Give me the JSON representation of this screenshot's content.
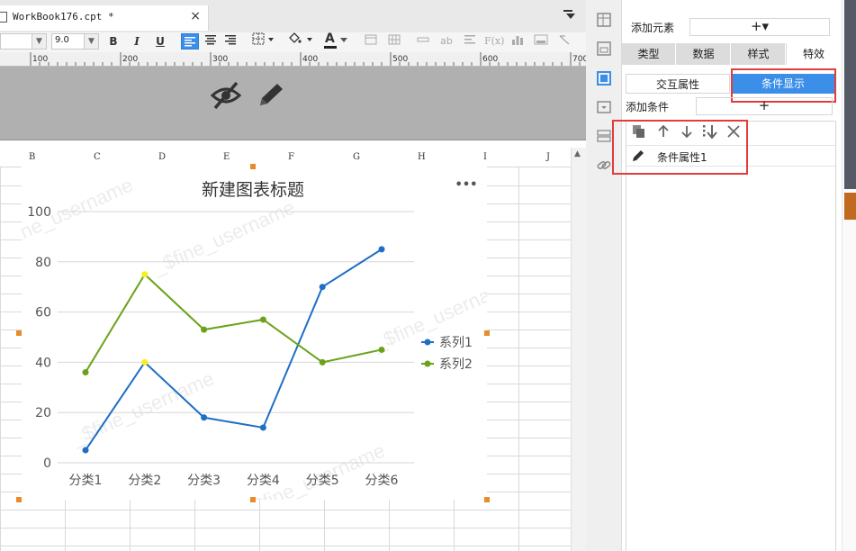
{
  "tab": {
    "title": "WorkBook176.cpt *",
    "close": "×"
  },
  "toolbar": {
    "font_size": "9.0",
    "bold": "B",
    "italic": "I",
    "underline": "U",
    "text_color_letter": "A",
    "formula_icon": "F(x)",
    "ab": "ab"
  },
  "ruler": {
    "ticks": [
      "100",
      "200",
      "300",
      "400",
      "500",
      "600",
      "700"
    ]
  },
  "sheet": {
    "columns": [
      "B",
      "C",
      "D",
      "E",
      "F",
      "G",
      "H",
      "I",
      "J"
    ]
  },
  "watermark": "_$fine_username",
  "chart_data": {
    "type": "line",
    "title": "新建图表标题",
    "categories": [
      "分类1",
      "分类2",
      "分类3",
      "分类4",
      "分类5",
      "分类6"
    ],
    "series": [
      {
        "name": "系列1",
        "color": "#1f6fc4",
        "values": [
          5,
          40,
          18,
          14,
          70,
          85
        ]
      },
      {
        "name": "系列2",
        "color": "#6aa31a",
        "values": [
          36,
          75,
          53,
          57,
          40,
          45
        ]
      }
    ],
    "highlight_points": [
      {
        "series": "系列1",
        "category": "分类2",
        "color": "#f6f01a"
      },
      {
        "series": "系列2",
        "category": "分类2",
        "color": "#f6f01a"
      }
    ],
    "ylim": [
      0,
      100
    ],
    "yticks": [
      "0",
      "20",
      "40",
      "60",
      "80",
      "100"
    ],
    "grid": true,
    "legend_position": "right",
    "menu": "•••"
  },
  "right_panel": {
    "add_element_label": "添加元素",
    "add_element_button": "+▾",
    "tabs": [
      "类型",
      "数据",
      "样式",
      "特效"
    ],
    "sub_tabs": [
      "交互属性",
      "条件显示"
    ],
    "add_condition_label": "添加条件",
    "add_condition_button": "+",
    "condition_item": "条件属性1"
  },
  "colors": {
    "accent": "#3b8fe8",
    "highlight_box": "#e23c3c",
    "handle": "#e98b2a",
    "gray_panel": "#b0b0b0"
  },
  "icons": {
    "left_strip": [
      "cell-element-icon",
      "float-element-icon",
      "widget-settings-icon",
      "form-icon",
      "hyperlink-icon"
    ],
    "gray_panel": [
      "hide-eye-icon",
      "edit-pencil-icon"
    ],
    "condition_tools": [
      "copy-icon",
      "move-up-icon",
      "move-down-icon",
      "move-bottom-icon",
      "delete-icon"
    ]
  }
}
